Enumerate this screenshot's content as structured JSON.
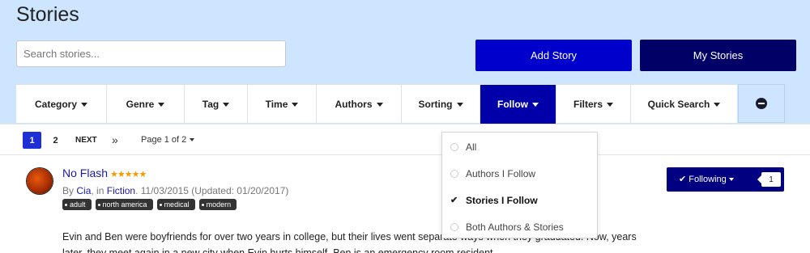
{
  "page": {
    "title": "Stories"
  },
  "search": {
    "placeholder": "Search stories..."
  },
  "buttons": {
    "add_story": "Add Story",
    "my_stories": "My Stories"
  },
  "colors": {
    "background": "#cde5ff",
    "add_button": "#0000cc",
    "my_stories_button": "#000066",
    "active_tab": "#0000aa",
    "star": "#f59b00",
    "link": "#1a1aa0"
  },
  "filters": [
    {
      "label": "Category",
      "active": false
    },
    {
      "label": "Genre",
      "active": false
    },
    {
      "label": "Tag",
      "active": false
    },
    {
      "label": "Time",
      "active": false
    },
    {
      "label": "Authors",
      "active": false
    },
    {
      "label": "Sorting",
      "active": false
    },
    {
      "label": "Follow",
      "active": true
    },
    {
      "label": "Filters",
      "active": false
    },
    {
      "label": "Quick Search",
      "active": false
    }
  ],
  "toggle_icon": "minus-circle-icon",
  "pagination": {
    "pages": [
      "1",
      "2"
    ],
    "current": "1",
    "next": "NEXT",
    "last": "»",
    "info": "Page 1 of 2"
  },
  "follow_dropdown": {
    "items": [
      {
        "label": "All",
        "selected": false
      },
      {
        "label": "Authors I Follow",
        "selected": false
      },
      {
        "label": "Stories I Follow",
        "selected": true
      },
      {
        "label": "Both Authors & Stories",
        "selected": false
      }
    ]
  },
  "story": {
    "title": "No Flash",
    "stars": "★★★★★",
    "rating": 5,
    "by_prefix": "By",
    "author": "Cia",
    "in_sep": ", in",
    "category": "Fiction",
    "dates": ". 11/03/2015 (Updated: 01/20/2017)",
    "tags": [
      "adult",
      "north america",
      "medical",
      "modern"
    ],
    "description": "Evin and Ben were boyfriends for over two years in college, but their lives went separate ways when they graduated. Now, years later, they meet again in a new city when Evin hurts himself. Ben is an emergency room resident.",
    "follow_label": "Following",
    "follow_count": "1"
  }
}
